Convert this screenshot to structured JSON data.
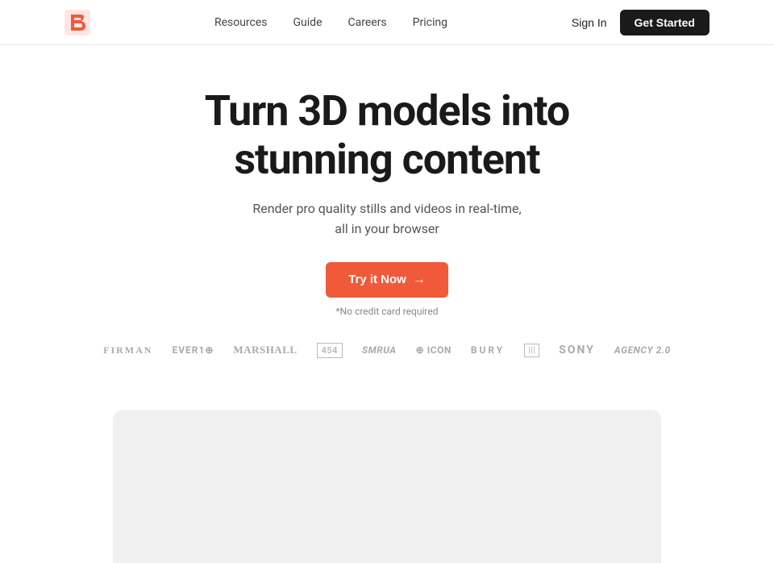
{
  "navbar": {
    "logo_alt": "OuSted logo",
    "links": [
      {
        "label": "Resources",
        "id": "resources"
      },
      {
        "label": "Guide",
        "id": "guide"
      },
      {
        "label": "Careers",
        "id": "careers"
      },
      {
        "label": "Pricing",
        "id": "pricing"
      }
    ],
    "sign_in": "Sign In",
    "get_started": "Get Started"
  },
  "hero": {
    "title_line1": "Turn 3D models into",
    "title_line2": "stunning content",
    "subtitle_line1": "Render pro quality stills and videos in real-time,",
    "subtitle_line2": "all in your browser",
    "cta_label": "Try it Now",
    "cta_arrow": "→",
    "no_cc": "*No credit card required"
  },
  "brands": [
    {
      "label": "FIRMAN",
      "class": "firman"
    },
    {
      "label": "EVER1⊕",
      "class": "ever1"
    },
    {
      "label": "Marshall",
      "class": "marshall"
    },
    {
      "label": "454",
      "class": "f454"
    },
    {
      "label": "smrua",
      "class": "smrua"
    },
    {
      "label": "⊕ ICON",
      "class": "icon-brand"
    },
    {
      "label": "BURY",
      "class": "bury"
    },
    {
      "label": "|||",
      "class": "grid-brand"
    },
    {
      "label": "SONY",
      "class": "sony"
    },
    {
      "label": "Agency 2.0",
      "class": "agency20"
    }
  ]
}
